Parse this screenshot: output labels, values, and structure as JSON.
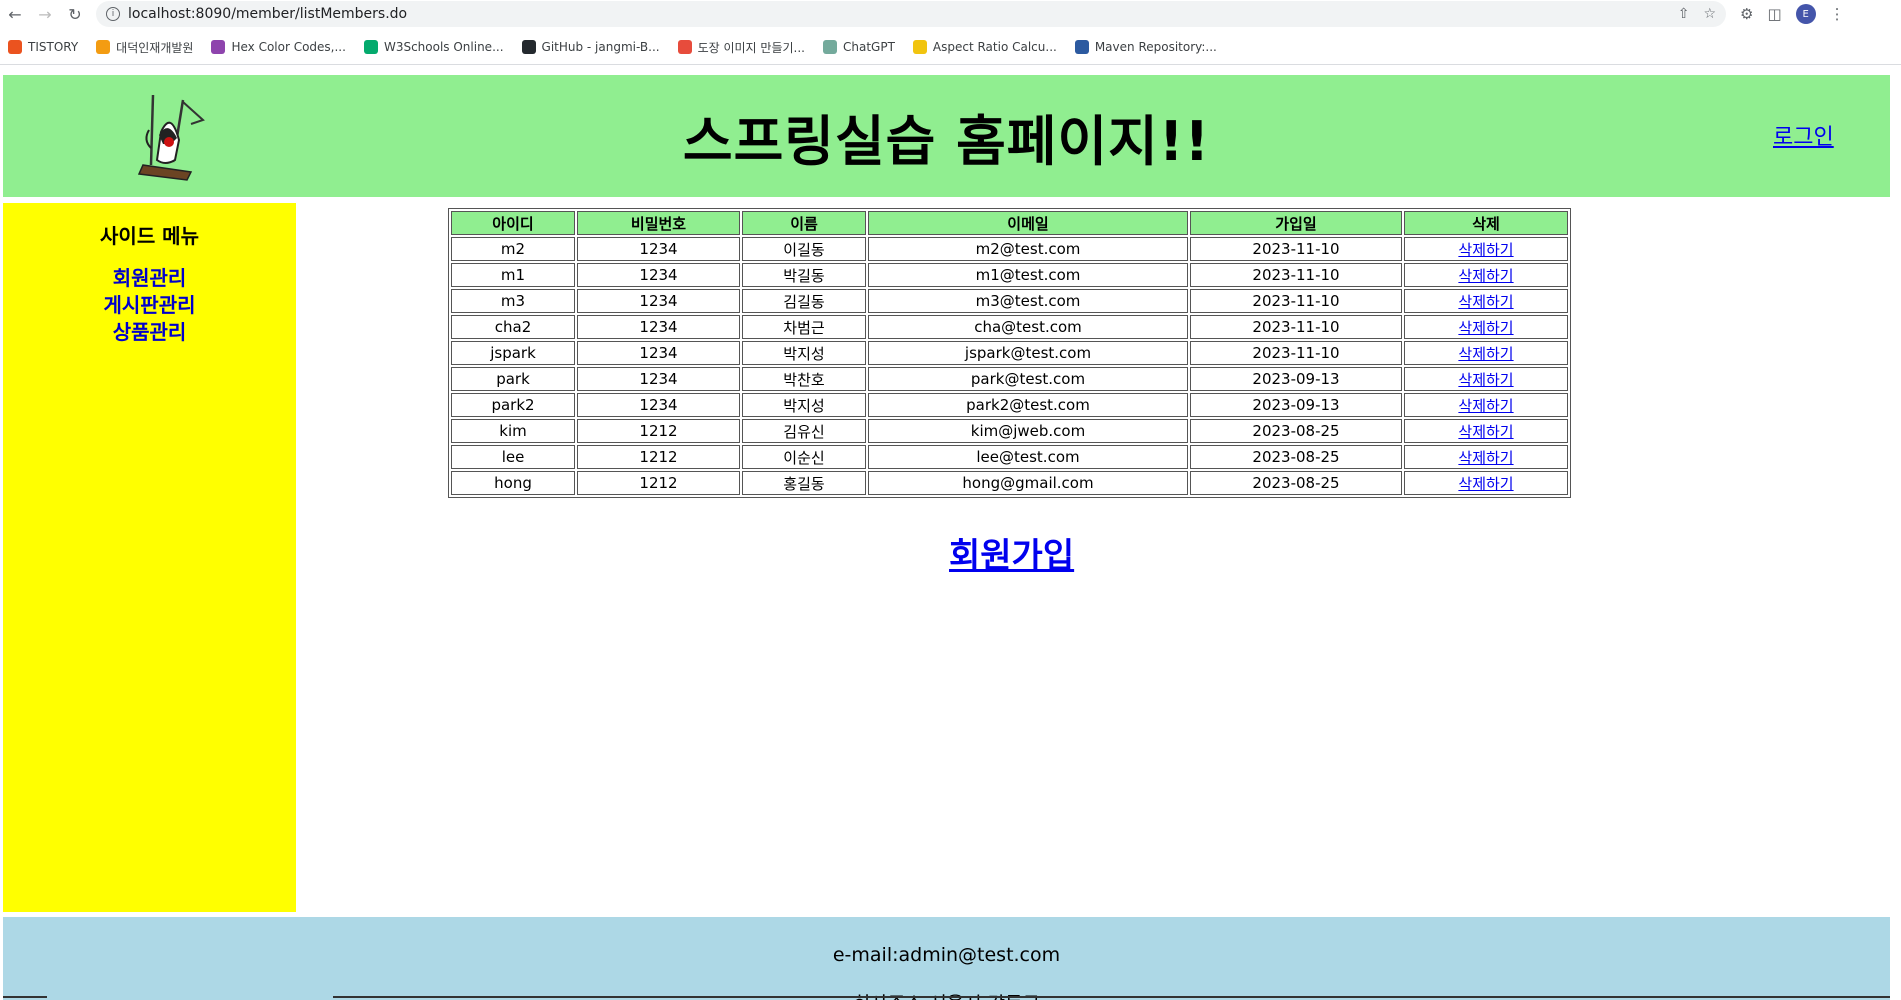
{
  "browser": {
    "url": "localhost:8090/member/listMembers.do",
    "bookmarks": [
      {
        "label": "TISTORY",
        "icon": "tistory-icon",
        "color": "#eb531f"
      },
      {
        "label": "대덕인재개발원",
        "icon": "ddit-icon",
        "color": "#f39c12"
      },
      {
        "label": "Hex Color Codes,...",
        "icon": "hex-color-icon",
        "color": "#8e44ad"
      },
      {
        "label": "W3Schools Online...",
        "icon": "w3schools-icon",
        "color": "#04aa6d"
      },
      {
        "label": "GitHub - jangmi-B...",
        "icon": "github-icon",
        "color": "#24292e"
      },
      {
        "label": "도장 이미지 만들기...",
        "icon": "stamp-icon",
        "color": "#e74c3c"
      },
      {
        "label": "ChatGPT",
        "icon": "chatgpt-icon",
        "color": "#74aa9c"
      },
      {
        "label": "Aspect Ratio Calcu...",
        "icon": "aspect-ratio-icon",
        "color": "#f1c40f"
      },
      {
        "label": "Maven Repository:...",
        "icon": "maven-icon",
        "color": "#2c5aa0"
      }
    ],
    "profile_initial": "E"
  },
  "header": {
    "title": "스프링실습 홈페이지!!",
    "login_label": "로그인",
    "bg_color": "#90ee90"
  },
  "sidebar": {
    "title": "사이드 메뉴",
    "items": [
      {
        "label": "회원관리"
      },
      {
        "label": "게시판관리"
      },
      {
        "label": "상품관리"
      }
    ],
    "bg_color": "#ffff00"
  },
  "table": {
    "columns": [
      "아이디",
      "비밀번호",
      "이름",
      "이메일",
      "가입일",
      "삭제"
    ],
    "rows": [
      {
        "id": "m2",
        "pwd": "1234",
        "name": "이길동",
        "email": "m2@test.com",
        "joined": "2023-11-10",
        "delete": "삭제하기"
      },
      {
        "id": "m1",
        "pwd": "1234",
        "name": "박길동",
        "email": "m1@test.com",
        "joined": "2023-11-10",
        "delete": "삭제하기"
      },
      {
        "id": "m3",
        "pwd": "1234",
        "name": "김길동",
        "email": "m3@test.com",
        "joined": "2023-11-10",
        "delete": "삭제하기"
      },
      {
        "id": "cha2",
        "pwd": "1234",
        "name": "차범근",
        "email": "cha@test.com",
        "joined": "2023-11-10",
        "delete": "삭제하기"
      },
      {
        "id": "jspark",
        "pwd": "1234",
        "name": "박지성",
        "email": "jspark@test.com",
        "joined": "2023-11-10",
        "delete": "삭제하기"
      },
      {
        "id": "park",
        "pwd": "1234",
        "name": "박찬호",
        "email": "park@test.com",
        "joined": "2023-09-13",
        "delete": "삭제하기"
      },
      {
        "id": "park2",
        "pwd": "1234",
        "name": "박지성",
        "email": "park2@test.com",
        "joined": "2023-09-13",
        "delete": "삭제하기"
      },
      {
        "id": "kim",
        "pwd": "1212",
        "name": "김유신",
        "email": "kim@jweb.com",
        "joined": "2023-08-25",
        "delete": "삭제하기"
      },
      {
        "id": "lee",
        "pwd": "1212",
        "name": "이순신",
        "email": "lee@test.com",
        "joined": "2023-08-25",
        "delete": "삭제하기"
      },
      {
        "id": "hong",
        "pwd": "1212",
        "name": "홍길동",
        "email": "hong@gmail.com",
        "joined": "2023-08-25",
        "delete": "삭제하기"
      }
    ]
  },
  "join_label": "회원가입",
  "footer": {
    "email": "e-mail:admin@test.com",
    "address": "회사주소:서울시 강동구",
    "bg_color": "#add8e6"
  }
}
